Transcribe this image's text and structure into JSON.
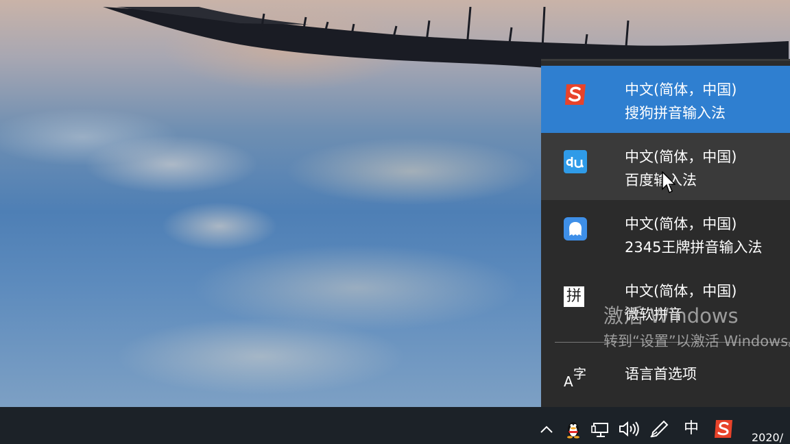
{
  "ime_menu": {
    "items": [
      {
        "language": "中文(简体，中国)",
        "name": "搜狗拼音输入法",
        "icon": "sogou-icon",
        "state": "selected"
      },
      {
        "language": "中文(简体，中国)",
        "name": "百度输入法",
        "icon": "baidu-ime-icon",
        "state": "hover"
      },
      {
        "language": "中文(简体，中国)",
        "name": "2345王牌拼音输入法",
        "icon": "2345-ime-icon",
        "state": "normal"
      },
      {
        "language": "中文(简体，中国)",
        "name": "微软拼音",
        "icon": "microsoft-pinyin-icon",
        "state": "normal"
      }
    ],
    "language_preferences": "语言首选项",
    "microsoft_pinyin_glyph": "拼",
    "language_pref_glyph_a": "A",
    "language_pref_glyph_zi": "字"
  },
  "watermark": {
    "title": "激活 Windows",
    "subtitle": "转到“设置”以激活 Windows。"
  },
  "taskbar": {
    "ime_mode": "中",
    "clock_date": "2020/"
  },
  "colors": {
    "selected": "#2f7fd0",
    "popup_bg": "#2b2b2b",
    "taskbar_bg": "#1c2228",
    "sogou_red": "#e8432a"
  }
}
